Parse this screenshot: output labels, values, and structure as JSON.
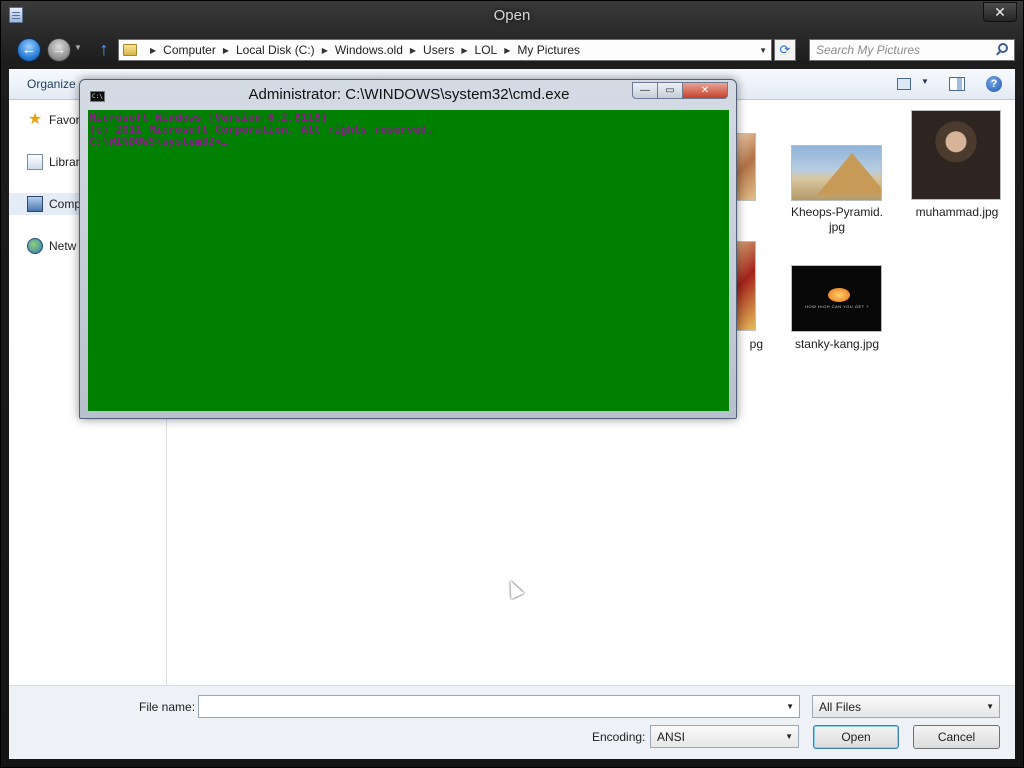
{
  "dialog": {
    "title": "Open",
    "close_glyph": "✕"
  },
  "nav": {
    "back_glyph": "←",
    "forward_glyph": "→",
    "up_glyph": "↑",
    "breadcrumb": [
      "Computer",
      "Local Disk (C:)",
      "Windows.old",
      "Users",
      "LOL",
      "My Pictures"
    ],
    "search_placeholder": "Search My Pictures"
  },
  "toolbar": {
    "organize_label": "Organize",
    "help_glyph": "?"
  },
  "sidebar": {
    "items": [
      {
        "label": "Favor",
        "icon": "star-icon"
      },
      {
        "label": "Librar",
        "icon": "library-icon"
      },
      {
        "label": "Comp",
        "icon": "computer-icon"
      },
      {
        "label": "Netw",
        "icon": "network-icon"
      }
    ]
  },
  "files": [
    {
      "name": "Kheops-Pyramid.\njpg",
      "line1": "Kheops-Pyramid.",
      "line2": "jpg",
      "thumb": "pyramid"
    },
    {
      "name": "muhammad.jpg",
      "line1": "muhammad.jpg",
      "line2": "",
      "thumb": "portrait"
    },
    {
      "name": "stanky-kang.jpg",
      "line1": "stanky-kang.jpg",
      "line2": "",
      "thumb": "game",
      "thumb_text": "HOW HIGH CAN YOU GET ?"
    },
    {
      "name": "pg",
      "line1": "pg",
      "line2": "",
      "thumb": "partial"
    }
  ],
  "bottom": {
    "filename_label": "File name:",
    "filename_value": "",
    "filetype_value": "All Files",
    "encoding_label": "Encoding:",
    "encoding_value": "ANSI",
    "open_label": "Open",
    "cancel_label": "Cancel"
  },
  "cmd": {
    "title": "Administrator: C:\\WINDOWS\\system32\\cmd.exe",
    "icon_text": "C:\\",
    "line1": "Microsoft Windows [Version 6.2.8118]",
    "line2": "(c) 2011 Microsoft Corporation. All rights reserved.",
    "line3": "",
    "prompt": "C:\\WINDOWS\\system32>",
    "background_color": "#008000",
    "text_color": "#8b1a8b"
  }
}
